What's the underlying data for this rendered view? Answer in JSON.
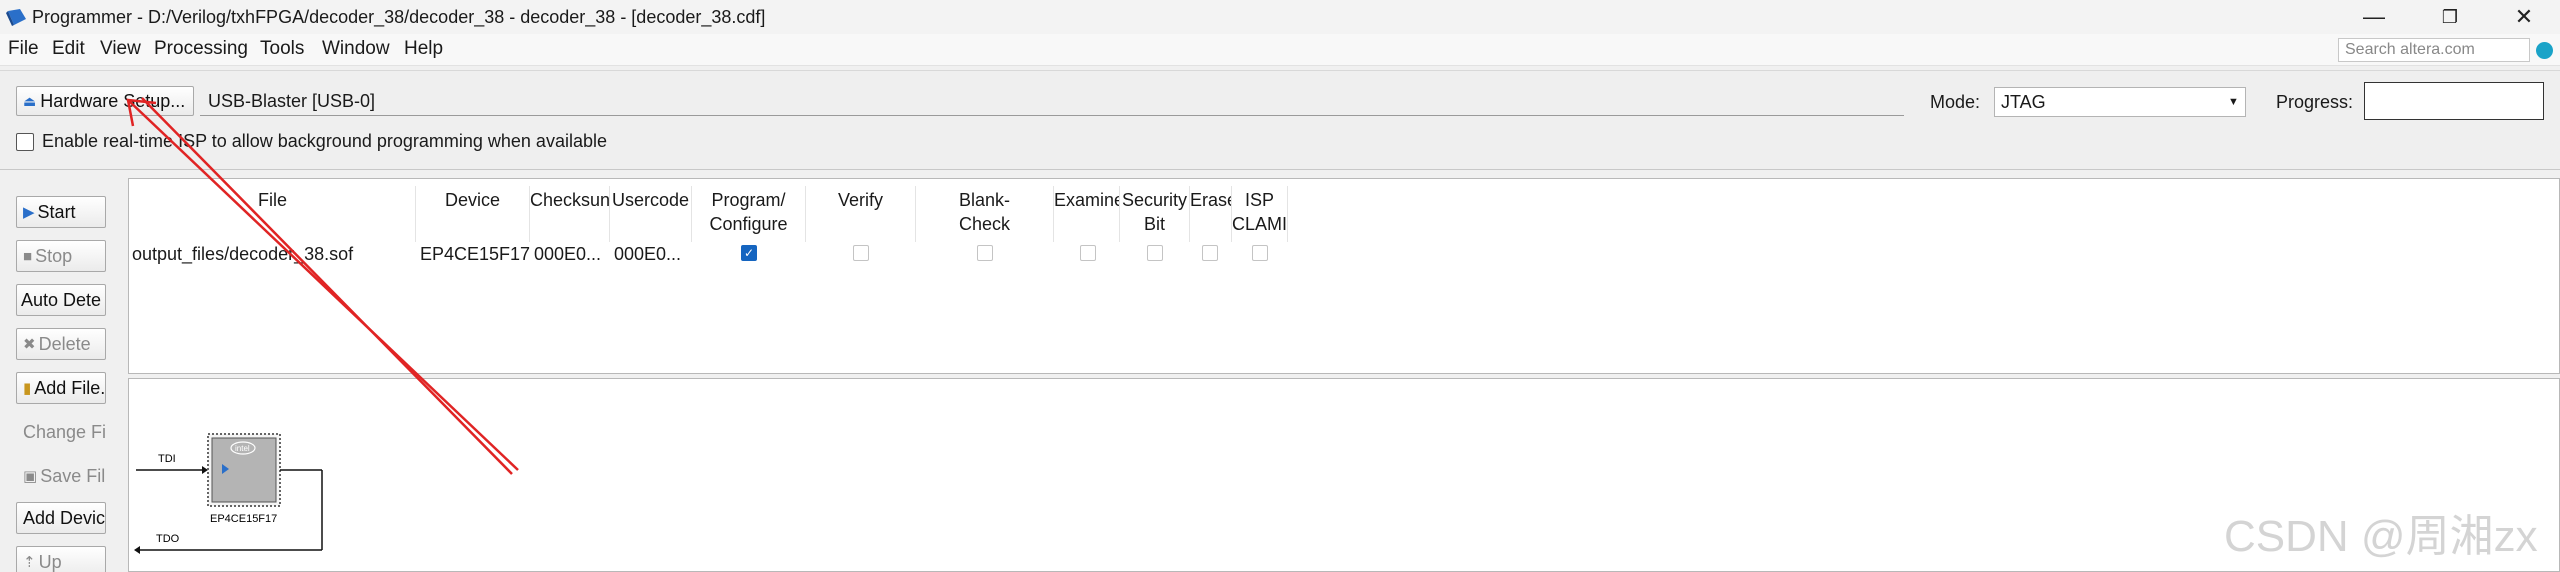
{
  "window": {
    "title": "Programmer - D:/Verilog/txhFPGA/decoder_38/decoder_38 - decoder_38 - [decoder_38.cdf]",
    "minimize_glyph": "—",
    "restore_glyph": "❐",
    "close_glyph": "✕"
  },
  "menu": {
    "items": [
      "File",
      "Edit",
      "View",
      "Processing",
      "Tools",
      "Window",
      "Help"
    ],
    "search_placeholder": "Search altera.com"
  },
  "hardware": {
    "setup_label": "Hardware Setup...",
    "device_name": "USB-Blaster [USB-0]",
    "mode_label": "Mode:",
    "mode_value": "JTAG",
    "progress_label": "Progress:",
    "progress_value": 0,
    "isp_label": "Enable real-time ISP to allow background programming when available",
    "isp_checked": false
  },
  "toolbar": {
    "start": "Start",
    "stop": "Stop",
    "auto_detect": "Auto Dete",
    "delete": "Delete",
    "add_file": "Add File.",
    "change_file": "Change Fil",
    "save_file": "Save File",
    "add_device": "Add Devic",
    "up": "Up"
  },
  "table": {
    "headers": {
      "file": "File",
      "device": "Device",
      "checksum": "Checksun",
      "usercode": "Usercode",
      "program_1": "Program/",
      "program_2": "Configure",
      "verify": "Verify",
      "blank_1": "Blank-",
      "blank_2": "Check",
      "examine": "Examine",
      "security_1": "Security",
      "security_2": "Bit",
      "erase": "Erase",
      "isp_1": "ISP",
      "isp_2": "CLAMI"
    },
    "row": {
      "file": "output_files/decoder_38.sof",
      "device": "EP4CE15F17",
      "checksum": "000E0...",
      "usercode": "000E0...",
      "program_configure": true,
      "verify": false,
      "blank_check": false,
      "examine": false,
      "security_bit": false,
      "erase": false,
      "isp_clamp": false
    }
  },
  "chain": {
    "tdi": "TDI",
    "tdo": "TDO",
    "chip_label": "EP4CE15F17",
    "chip_logo": "intel"
  },
  "watermark": "CSDN @周湘zx",
  "colors": {
    "accent_blue": "#1565c0",
    "annotation_red": "#e02424",
    "search_icon": "#1aa3c8"
  }
}
